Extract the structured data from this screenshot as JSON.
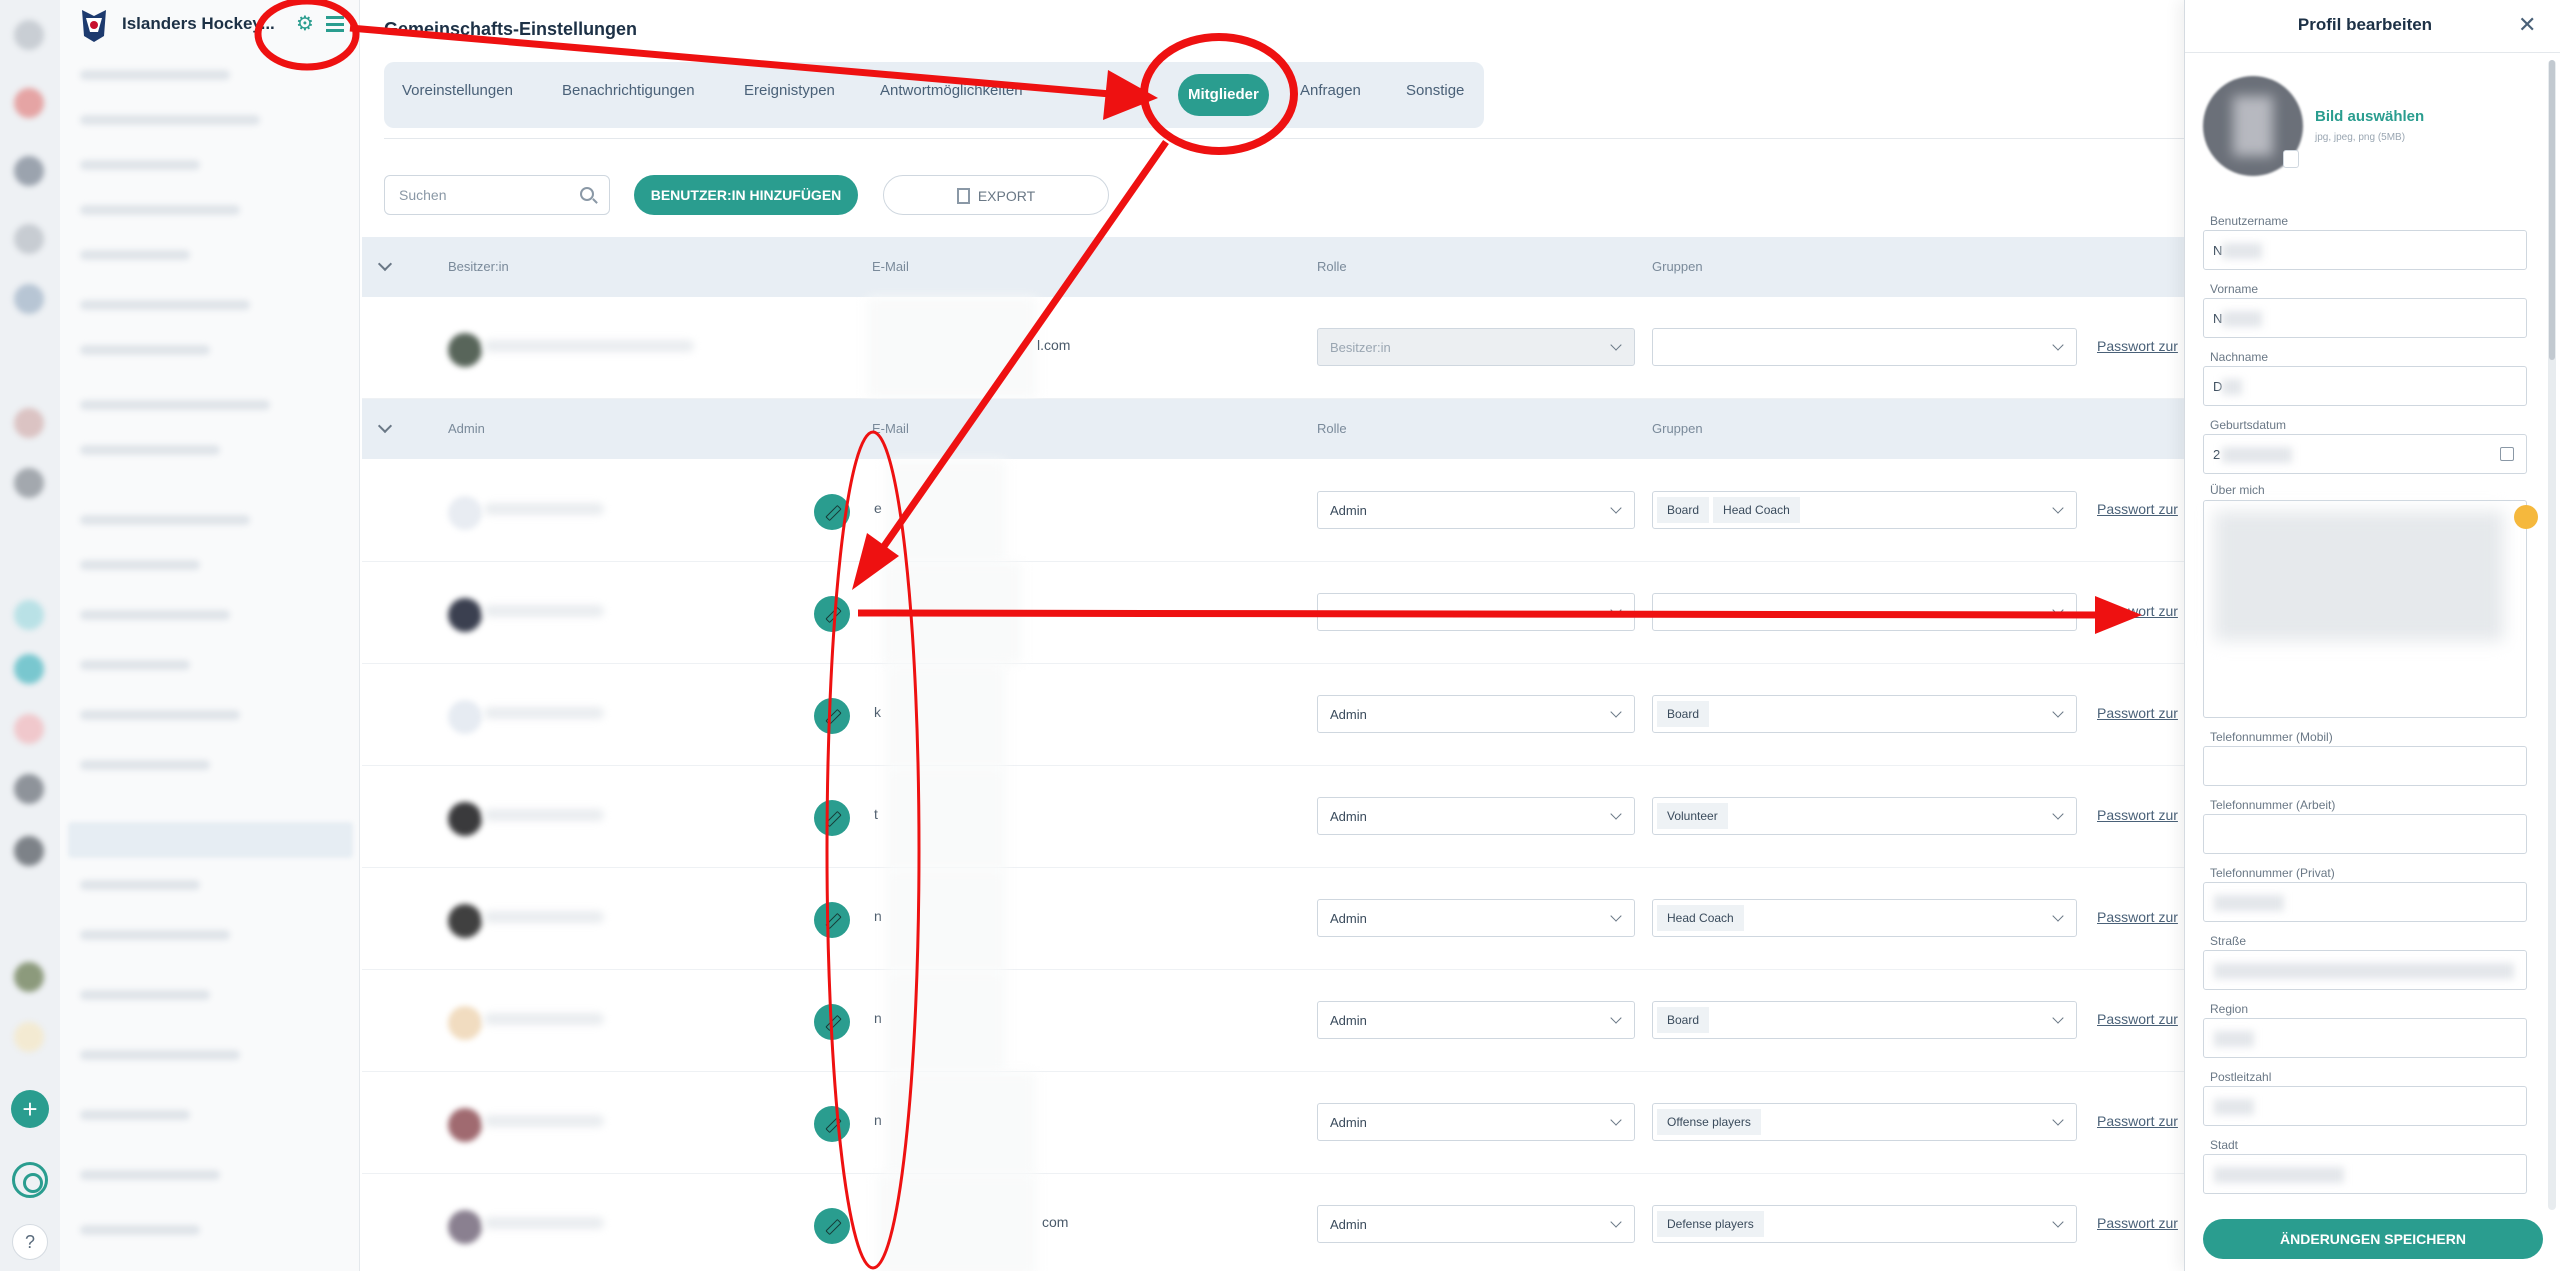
{
  "app": {
    "club_name": "Islanders Hockey..."
  },
  "page": {
    "title": "Gemeinschafts-Einstellungen"
  },
  "tabs": [
    {
      "label": "Voreinstellungen"
    },
    {
      "label": "Benachrichtigungen"
    },
    {
      "label": "Ereignistypen"
    },
    {
      "label": "Antwortmöglichkeiten"
    },
    {
      "label": "Mitglieder",
      "active": true
    },
    {
      "label": "Anfragen"
    },
    {
      "label": "Sonstige"
    }
  ],
  "toolbar": {
    "search_placeholder": "Suchen",
    "add_user_label": "BENUTZER:IN HINZUFÜGEN",
    "export_label": "EXPORT"
  },
  "owner_section": {
    "headers": {
      "name": "Besitzer:in",
      "email": "E-Mail",
      "role": "Rolle",
      "groups": "Gruppen"
    },
    "row": {
      "email_visible": "l.com",
      "role": "Besitzer:in",
      "groups": [],
      "password_link": "Passwort zur"
    }
  },
  "admin_section": {
    "headers": {
      "name": "Admin",
      "email": "E-Mail",
      "role": "Rolle",
      "groups": "Gruppen"
    },
    "rows": [
      {
        "email_visible": "e",
        "role": "Admin",
        "groups": [
          "Board",
          "Head Coach"
        ],
        "password_link": "Passwort zur"
      },
      {
        "email_visible": "",
        "role": "",
        "groups": [],
        "password_link": "Passwort zur"
      },
      {
        "email_visible": "k",
        "role": "Admin",
        "groups": [
          "Board"
        ],
        "password_link": "Passwort zur"
      },
      {
        "email_visible": "t",
        "role": "Admin",
        "groups": [
          "Volunteer"
        ],
        "password_link": "Passwort zur"
      },
      {
        "email_visible": "n",
        "role": "Admin",
        "groups": [
          "Head Coach"
        ],
        "password_link": "Passwort zur"
      },
      {
        "email_visible": "n",
        "role": "Admin",
        "groups": [
          "Board"
        ],
        "password_link": "Passwort zur"
      },
      {
        "email_visible": "n",
        "role": "Admin",
        "groups": [
          "Offense players"
        ],
        "password_link": "Passwort zur"
      },
      {
        "email_visible": "com",
        "role": "Admin",
        "groups": [
          "Defense players"
        ],
        "password_link": "Passwort zur"
      }
    ]
  },
  "profile_panel": {
    "title": "Profil bearbeiten",
    "pick_image_label": "Bild auswählen",
    "image_hint": "jpg, jpeg, png (5MB)",
    "fields": [
      {
        "label": "Benutzername",
        "value": "N"
      },
      {
        "label": "Vorname",
        "value": "N"
      },
      {
        "label": "Nachname",
        "value": "D"
      },
      {
        "label": "Geburtsdatum",
        "value": "2"
      },
      {
        "label": "Über mich",
        "value": ""
      },
      {
        "label": "Telefonnummer (Mobil)",
        "value": ""
      },
      {
        "label": "Telefonnummer (Arbeit)",
        "value": ""
      },
      {
        "label": "Telefonnummer (Privat)",
        "value": ""
      },
      {
        "label": "Straße",
        "value": ""
      },
      {
        "label": "Region",
        "value": ""
      },
      {
        "label": "Postleitzahl",
        "value": ""
      },
      {
        "label": "Stadt",
        "value": ""
      }
    ],
    "save_label": "ÄNDERUNGEN SPEICHERN"
  },
  "colors": {
    "accent": "#2a9d8f",
    "annotation": "#ee1111",
    "band": "#e8eef4"
  },
  "icons": [
    "settings-gear-icon",
    "hamburger-menu-icon",
    "search-icon",
    "document-icon",
    "pencil-edit-icon",
    "calendar-icon",
    "emoji-icon",
    "close-icon",
    "plus-icon",
    "help-icon"
  ]
}
